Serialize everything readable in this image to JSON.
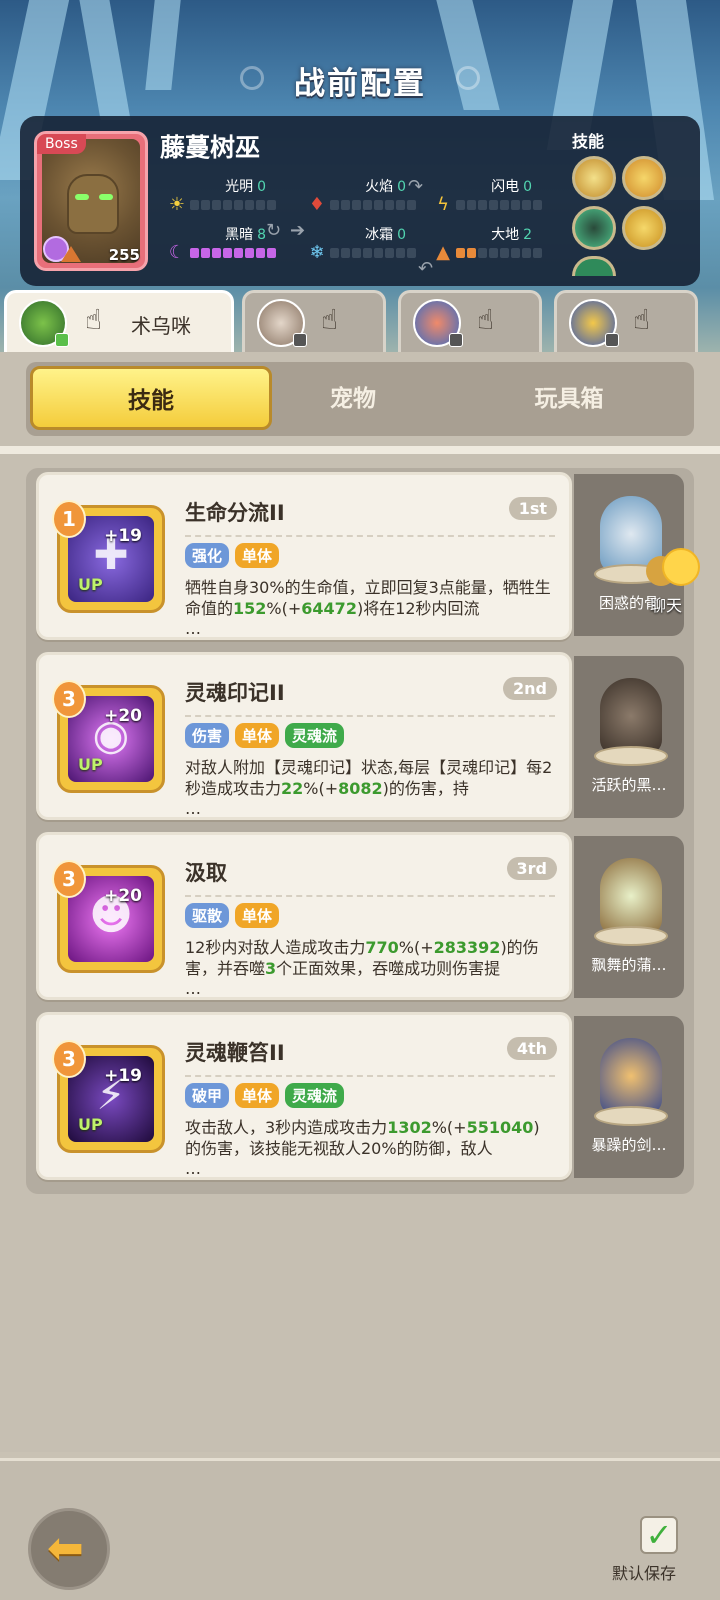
{
  "page_title": "战前配置",
  "boss": {
    "tag": "Boss",
    "name": "藤蔓树巫",
    "level": "255",
    "skills_label": "技能"
  },
  "elements": [
    {
      "label": "光明",
      "value": "0",
      "icon": "sun-icon"
    },
    {
      "label": "火焰",
      "value": "0",
      "icon": "fire-icon"
    },
    {
      "label": "闪电",
      "value": "0",
      "icon": "lightning-icon"
    },
    {
      "label": "黑暗",
      "value": "8",
      "icon": "moon-icon"
    },
    {
      "label": "冰霜",
      "value": "0",
      "icon": "snowflake-icon"
    },
    {
      "label": "大地",
      "value": "2",
      "icon": "earth-icon"
    }
  ],
  "heroes": [
    {
      "name": "术乌咪",
      "active": true
    },
    {
      "name": "",
      "active": false
    },
    {
      "name": "",
      "active": false
    },
    {
      "name": "",
      "active": false
    }
  ],
  "tabs": [
    "技能",
    "宠物",
    "玩具箱"
  ],
  "active_tab": "技能",
  "skills": [
    {
      "level": "1",
      "plus": "+19",
      "up": "UP",
      "title": "生命分流II",
      "rank": "1st",
      "tags": [
        "强化",
        "单体"
      ],
      "desc_parts": [
        "牺牲自身30%的生命值，立即回复3点能量，牺牲生命值的",
        "152",
        "%(+",
        "64472",
        ")将在12秒内回流"
      ],
      "ellipsis": "…"
    },
    {
      "level": "3",
      "plus": "+20",
      "up": "UP",
      "title": "灵魂印记II",
      "rank": "2nd",
      "tags": [
        "伤害",
        "单体",
        "灵魂流"
      ],
      "desc_parts": [
        "对敌人附加【灵魂印记】状态,每层【灵魂印记】每2秒造成攻击力",
        "22",
        "%(+",
        "8082",
        ")的伤害，持"
      ],
      "ellipsis": "…"
    },
    {
      "level": "3",
      "plus": "+20",
      "up": "",
      "title": "汲取",
      "rank": "3rd",
      "tags": [
        "驱散",
        "单体"
      ],
      "desc_parts": [
        "12秒内对敌人造成攻击力",
        "770",
        "%(+",
        "283392",
        ")的伤害，并吞噬",
        "3",
        "个正面效果，吞噬成功则伤害提"
      ],
      "ellipsis": "…"
    },
    {
      "level": "3",
      "plus": "+19",
      "up": "UP",
      "title": "灵魂鞭笞II",
      "rank": "4th",
      "tags": [
        "破甲",
        "单体",
        "灵魂流"
      ],
      "desc_parts": [
        "攻击敌人，3秒内造成攻击力",
        "1302",
        "%(+",
        "551040",
        ")的伤害，该技能无视敌人20%的防御，敌人"
      ],
      "ellipsis": "…"
    }
  ],
  "pets": [
    {
      "name": "困惑的骨"
    },
    {
      "name": "活跃的黑…"
    },
    {
      "name": "飘舞的蒲…"
    },
    {
      "name": "暴躁的剑…"
    }
  ],
  "chat_label": "聊天",
  "save_label": "默认保存",
  "colors": {
    "accent": "#f4cc3b",
    "green": "#3c9a2e",
    "tag_blue": "#6d97d8",
    "tag_orange": "#f0a627",
    "tag_green": "#3faa4a"
  }
}
